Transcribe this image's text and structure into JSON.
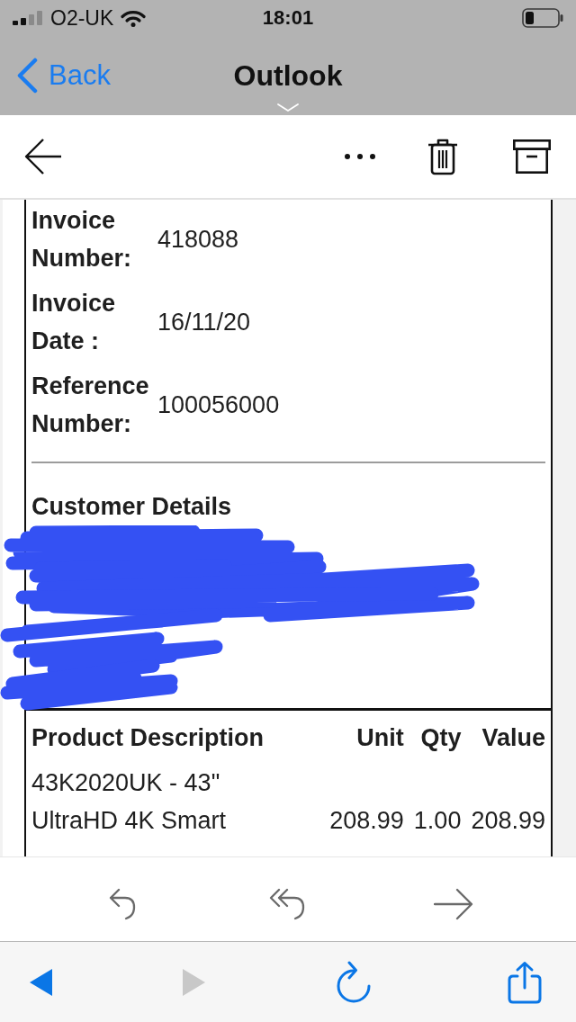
{
  "status_bar": {
    "carrier": "O2-UK",
    "time": "18:01"
  },
  "nav_bar": {
    "back_label": "Back",
    "title": "Outlook"
  },
  "invoice_fields": [
    {
      "label": "Invoice Number:",
      "value": "418088"
    },
    {
      "label": "Invoice Date :",
      "value": "16/11/20"
    },
    {
      "label": "Reference Number:",
      "value": "100056000"
    }
  ],
  "customer_details": {
    "heading": "Customer Details",
    "redacted": true
  },
  "products": {
    "columns": [
      "Product Description",
      "Unit",
      "Qty",
      "Value"
    ],
    "rows": [
      {
        "description": "43K2020UK - 43\" UltraHD 4K Smart",
        "unit": "208.99",
        "qty": "1.00",
        "value": "208.99"
      }
    ]
  },
  "browser_toolbar": {
    "back": {
      "disabled": false
    },
    "forward": {
      "disabled": true
    }
  }
}
